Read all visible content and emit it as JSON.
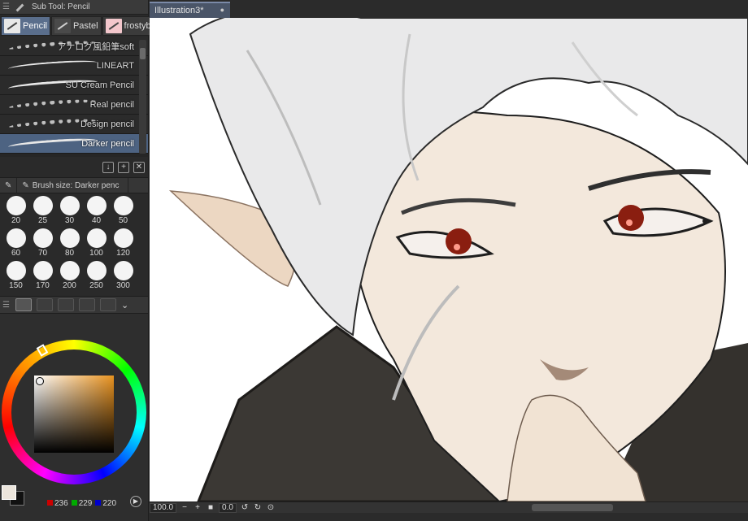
{
  "subtool_panel": {
    "title": "Sub Tool: Pencil"
  },
  "subtool_tabs": [
    {
      "label": "Pencil",
      "active": true
    },
    {
      "label": "Pastel",
      "active": false
    },
    {
      "label": "frostyb",
      "active": false
    }
  ],
  "brushes": [
    {
      "label": "アナログ風鉛筆soft",
      "active": false
    },
    {
      "label": "LINEART",
      "active": false
    },
    {
      "label": "SU Cream Pencil",
      "active": false
    },
    {
      "label": "Real pencil",
      "active": false
    },
    {
      "label": "Design pencil",
      "active": false
    },
    {
      "label": "Darker pencil",
      "active": true
    }
  ],
  "brush_size_panel": {
    "title": "Brush size: Darker penc"
  },
  "brush_sizes": [
    "20",
    "25",
    "30",
    "40",
    "50",
    "60",
    "70",
    "80",
    "100",
    "120",
    "150",
    "170",
    "200",
    "250",
    "300"
  ],
  "color": {
    "main_hex": "#ece5dc",
    "sub_hex": "#111111",
    "r": "236",
    "g": "229",
    "b": "220"
  },
  "document": {
    "tab_title": "Illustration3*"
  },
  "statusbar": {
    "zoom": "100.0",
    "rotation": "0.0"
  },
  "colors": {
    "panel_bg": "#2e2e2e",
    "active_row": "#4d6382",
    "tab_active": "#4a5568"
  }
}
